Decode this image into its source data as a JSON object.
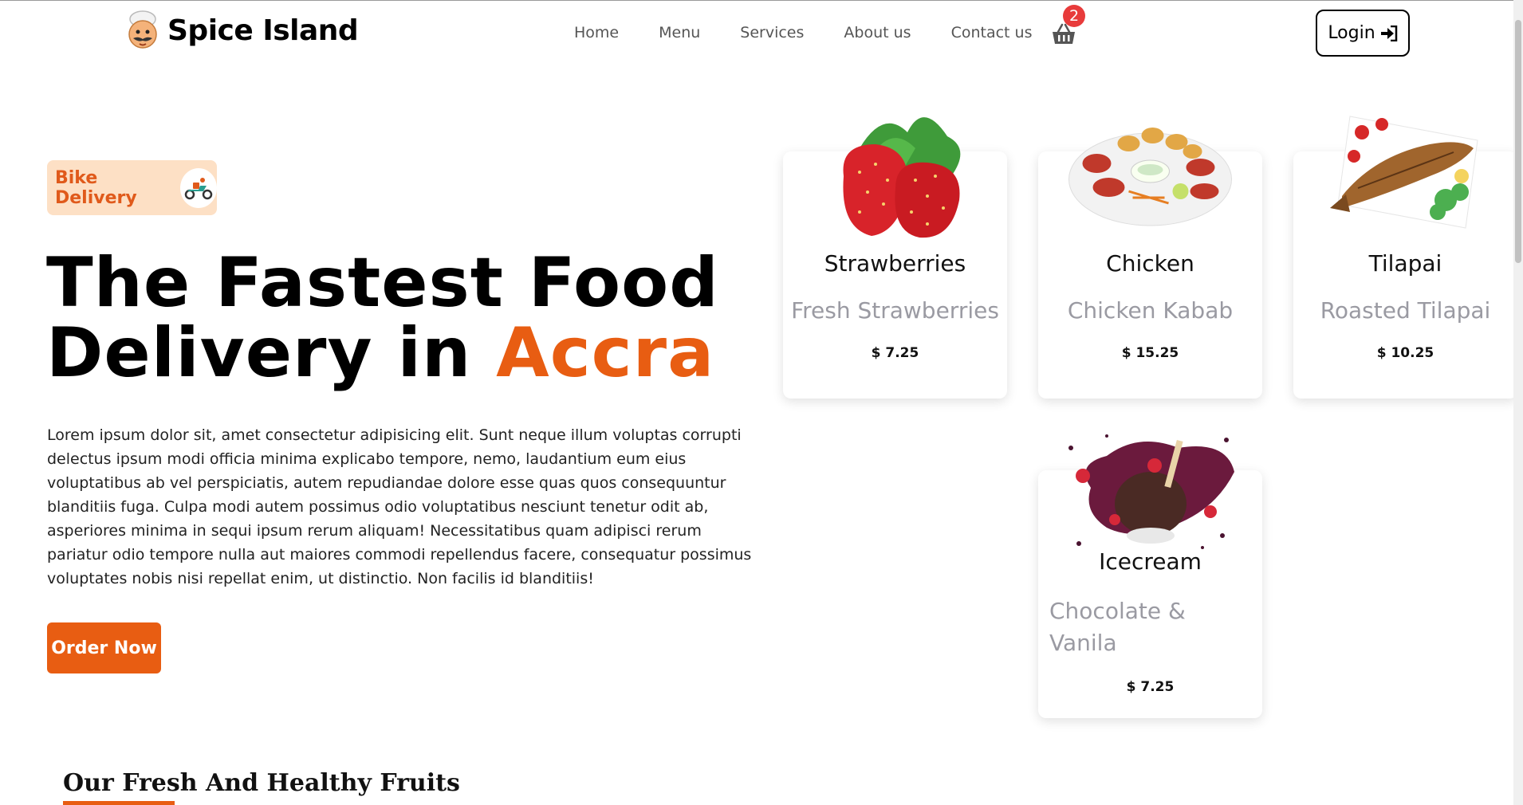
{
  "header": {
    "brand": "Spice Island",
    "nav": [
      "Home",
      "Menu",
      "Services",
      "About us",
      "Contact us"
    ],
    "cart_count": "2",
    "login_label": "Login"
  },
  "hero": {
    "badge": "Bike Delivery",
    "headline_part1": "The Fastest Food",
    "headline_part2": "Delivery in",
    "headline_accent": "Accra",
    "body": "Lorem ipsum dolor sit, amet consectetur adipisicing elit. Sunt neque illum voluptas corrupti delectus ipsum modi officia minima explicabo tempore, nemo, laudantium eum eius voluptatibus ab vel perspiciatis, autem repudiandae dolore esse quas quos consequuntur blanditiis fuga. Culpa modi autem possimus odio voluptatibus nesciunt tenetur odit ab, asperiores minima in sequi ipsum rerum aliquam! Necessitatibus quam adipisci rerum pariatur odio tempore nulla aut maiores commodi repellendus facere, consequatur possimus voluptates nobis nisi repellat enim, ut distinctio. Non facilis id blanditiis!",
    "order_label": "Order Now"
  },
  "cards": [
    {
      "name": "Strawberries",
      "desc": "Fresh Strawberries",
      "price": "$ 7.25"
    },
    {
      "name": "Chicken",
      "desc": "Chicken Kabab",
      "price": "$ 15.25"
    },
    {
      "name": "Tilapai",
      "desc": "Roasted Tilapai",
      "price": "$ 10.25"
    },
    {
      "name": "Icecream",
      "desc": "Chocolate & Vanila",
      "price": "$ 7.25"
    }
  ],
  "section": {
    "title": "Our Fresh And Healthy Fruits"
  },
  "colors": {
    "accent": "#e85d12",
    "badge_bg": "#fde0c5",
    "badge_red": "#e83b3b",
    "muted": "#9a9aa2"
  },
  "icons": {
    "cart": "basket-icon",
    "login": "sign-in-icon",
    "logo": "chef-logo-icon",
    "bike": "scooter-icon"
  }
}
